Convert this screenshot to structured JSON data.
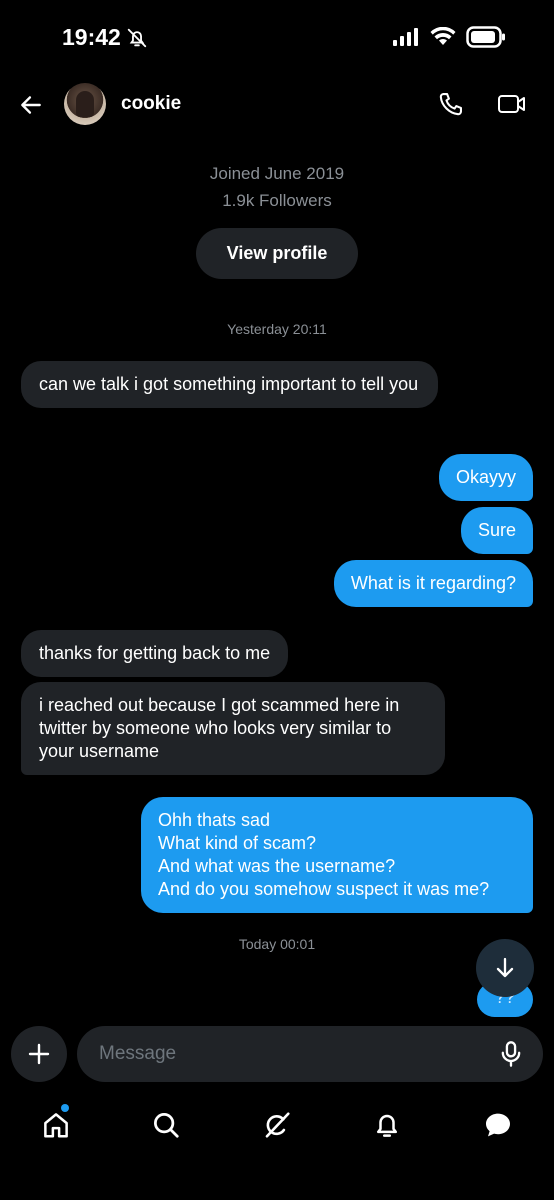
{
  "status_bar": {
    "time": "19:42"
  },
  "header": {
    "contact_name": "cookie"
  },
  "profile": {
    "joined": "Joined June 2019",
    "followers": "1.9k Followers",
    "view_profile_label": "View profile"
  },
  "conversation": {
    "timestamps": [
      "Yesterday 20:11",
      "Today 00:01"
    ],
    "messages": [
      {
        "direction": "in",
        "text": "can we talk i got something important to tell you"
      },
      {
        "direction": "out",
        "text": "Okayyy"
      },
      {
        "direction": "out",
        "text": "Sure"
      },
      {
        "direction": "out",
        "text": "What is it regarding?"
      },
      {
        "direction": "in",
        "text": "thanks for getting back to me"
      },
      {
        "direction": "in",
        "text": "i reached out because I got scammed here in twitter by someone who looks very similar to your username"
      },
      {
        "direction": "out",
        "text": "Ohh thats sad\nWhat kind of scam?\nAnd what was the username?\nAnd do you somehow suspect it was me?"
      },
      {
        "direction": "out",
        "text": "??"
      }
    ]
  },
  "composer": {
    "placeholder": "Message"
  },
  "colors": {
    "accent": "#1d9bf0",
    "incoming_bubble": "#202327",
    "background": "#000000"
  },
  "icons": [
    "back-arrow",
    "phone",
    "video-camera",
    "plus",
    "microphone",
    "arrow-down",
    "home",
    "search",
    "grok",
    "bell",
    "messages"
  ]
}
